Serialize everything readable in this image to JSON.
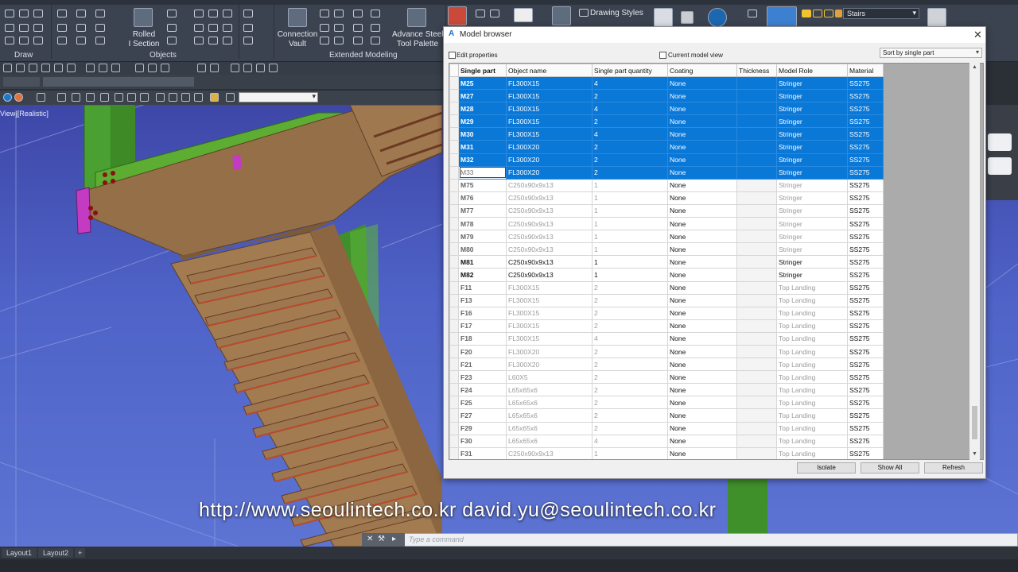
{
  "ribbon": {
    "groups": [
      {
        "label": "Draw"
      },
      {
        "label": "Objects"
      },
      {
        "label": "Extended Modeling"
      }
    ],
    "buttons": {
      "rolled_section": "Rolled\nI Section",
      "connection_vault": "Connection\nVault",
      "advance_steel_tool_palette": "Advance Steel\nTool Palette",
      "drawing_styles": "Drawing Styles"
    },
    "stairs_combo": "Stairs"
  },
  "viewport": {
    "label": "View][Realistic]"
  },
  "dialog": {
    "title": "Model browser",
    "edit_properties_label": "Edit properties",
    "edit_properties_checked": false,
    "current_model_view_label": "Current model view",
    "current_model_view_checked": false,
    "sort_by": "Sort by single part",
    "columns": [
      "Single part",
      "Object name",
      "Single part quantity",
      "Coating",
      "Thickness",
      "Model Role",
      "Material"
    ],
    "rows": [
      {
        "part": "M25",
        "object": "FL300X15",
        "qty": "4",
        "coating": "None",
        "thickness": "",
        "role": "Stringer",
        "material": "SS275",
        "state": "sel"
      },
      {
        "part": "M27",
        "object": "FL300X15",
        "qty": "2",
        "coating": "None",
        "thickness": "",
        "role": "Stringer",
        "material": "SS275",
        "state": "sel"
      },
      {
        "part": "M28",
        "object": "FL300X15",
        "qty": "4",
        "coating": "None",
        "thickness": "",
        "role": "Stringer",
        "material": "SS275",
        "state": "sel"
      },
      {
        "part": "M29",
        "object": "FL300X15",
        "qty": "2",
        "coating": "None",
        "thickness": "",
        "role": "Stringer",
        "material": "SS275",
        "state": "sel"
      },
      {
        "part": "M30",
        "object": "FL300X15",
        "qty": "4",
        "coating": "None",
        "thickness": "",
        "role": "Stringer",
        "material": "SS275",
        "state": "sel"
      },
      {
        "part": "M31",
        "object": "FL300X20",
        "qty": "2",
        "coating": "None",
        "thickness": "",
        "role": "Stringer",
        "material": "SS275",
        "state": "sel"
      },
      {
        "part": "M32",
        "object": "FL300X20",
        "qty": "2",
        "coating": "None",
        "thickness": "",
        "role": "Stringer",
        "material": "SS275",
        "state": "sel"
      },
      {
        "part": "M33",
        "object": "FL300X20",
        "qty": "2",
        "coating": "None",
        "thickness": "",
        "role": "Stringer",
        "material": "SS275",
        "state": "sel focus"
      },
      {
        "part": "M75",
        "object": "C250x90x9x13",
        "qty": "1",
        "coating": "None",
        "thickness": "",
        "role": "Stringer",
        "material": "SS275",
        "state": "dim"
      },
      {
        "part": "M76",
        "object": "C250x90x9x13",
        "qty": "1",
        "coating": "None",
        "thickness": "",
        "role": "Stringer",
        "material": "SS275",
        "state": "dim"
      },
      {
        "part": "M77",
        "object": "C250x90x9x13",
        "qty": "1",
        "coating": "None",
        "thickness": "",
        "role": "Stringer",
        "material": "SS275",
        "state": "dim"
      },
      {
        "part": "M78",
        "object": "C250x90x9x13",
        "qty": "1",
        "coating": "None",
        "thickness": "",
        "role": "Stringer",
        "material": "SS275",
        "state": "dim"
      },
      {
        "part": "M79",
        "object": "C250x90x9x13",
        "qty": "1",
        "coating": "None",
        "thickness": "",
        "role": "Stringer",
        "material": "SS275",
        "state": "dim"
      },
      {
        "part": "M80",
        "object": "C250x90x9x13",
        "qty": "1",
        "coating": "None",
        "thickness": "",
        "role": "Stringer",
        "material": "SS275",
        "state": "dim"
      },
      {
        "part": "M81",
        "object": "C250x90x9x13",
        "qty": "1",
        "coating": "None",
        "thickness": "",
        "role": "Stringer",
        "material": "SS275",
        "state": "dark"
      },
      {
        "part": "M82",
        "object": "C250x90x9x13",
        "qty": "1",
        "coating": "None",
        "thickness": "",
        "role": "Stringer",
        "material": "SS275",
        "state": "dark"
      },
      {
        "part": "F11",
        "object": "FL300X15",
        "qty": "2",
        "coating": "None",
        "thickness": "",
        "role": "Top Landing",
        "material": "SS275",
        "state": "dim"
      },
      {
        "part": "F13",
        "object": "FL300X15",
        "qty": "2",
        "coating": "None",
        "thickness": "",
        "role": "Top Landing",
        "material": "SS275",
        "state": "dim"
      },
      {
        "part": "F16",
        "object": "FL300X15",
        "qty": "2",
        "coating": "None",
        "thickness": "",
        "role": "Top Landing",
        "material": "SS275",
        "state": "dim"
      },
      {
        "part": "F17",
        "object": "FL300X15",
        "qty": "2",
        "coating": "None",
        "thickness": "",
        "role": "Top Landing",
        "material": "SS275",
        "state": "dim"
      },
      {
        "part": "F18",
        "object": "FL300X15",
        "qty": "4",
        "coating": "None",
        "thickness": "",
        "role": "Top Landing",
        "material": "SS275",
        "state": "dim"
      },
      {
        "part": "F20",
        "object": "FL300X20",
        "qty": "2",
        "coating": "None",
        "thickness": "",
        "role": "Top Landing",
        "material": "SS275",
        "state": "dim"
      },
      {
        "part": "F21",
        "object": "FL300X20",
        "qty": "2",
        "coating": "None",
        "thickness": "",
        "role": "Top Landing",
        "material": "SS275",
        "state": "dim"
      },
      {
        "part": "F23",
        "object": "L60X5",
        "qty": "2",
        "coating": "None",
        "thickness": "",
        "role": "Top Landing",
        "material": "SS275",
        "state": "dim"
      },
      {
        "part": "F24",
        "object": "L65x65x6",
        "qty": "2",
        "coating": "None",
        "thickness": "",
        "role": "Top Landing",
        "material": "SS275",
        "state": "dim"
      },
      {
        "part": "F25",
        "object": "L65x65x6",
        "qty": "2",
        "coating": "None",
        "thickness": "",
        "role": "Top Landing",
        "material": "SS275",
        "state": "dim"
      },
      {
        "part": "F27",
        "object": "L65x65x6",
        "qty": "2",
        "coating": "None",
        "thickness": "",
        "role": "Top Landing",
        "material": "SS275",
        "state": "dim"
      },
      {
        "part": "F29",
        "object": "L65x65x6",
        "qty": "2",
        "coating": "None",
        "thickness": "",
        "role": "Top Landing",
        "material": "SS275",
        "state": "dim"
      },
      {
        "part": "F30",
        "object": "L65x65x6",
        "qty": "4",
        "coating": "None",
        "thickness": "",
        "role": "Top Landing",
        "material": "SS275",
        "state": "dim"
      },
      {
        "part": "F31",
        "object": "C250x90x9x13",
        "qty": "1",
        "coating": "None",
        "thickness": "",
        "role": "Top Landing",
        "material": "SS275",
        "state": "dim"
      }
    ],
    "buttons": {
      "isolate": "Isolate",
      "show_all": "Show All",
      "refresh": "Refresh"
    }
  },
  "watermark": "http://www.seoulintech.co.kr  david.yu@seoulintech.co.kr",
  "command_line": {
    "placeholder": "Type a command"
  },
  "layout_tabs": [
    "Layout1",
    "Layout2",
    "+"
  ],
  "colors": {
    "selection": "#0a78d7",
    "viewport_sky": "#4f63c8",
    "steel_beam": "#8a6a47",
    "green_column": "#3f8f2a"
  }
}
